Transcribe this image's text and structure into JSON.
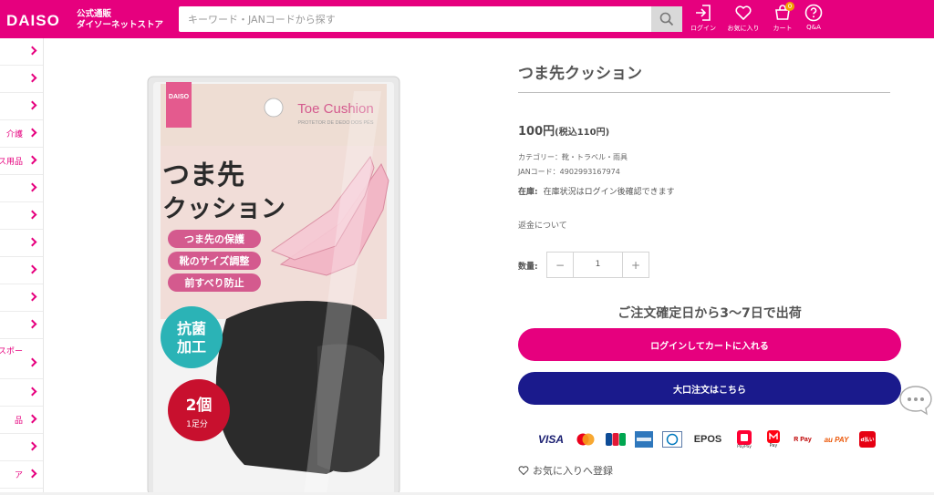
{
  "header": {
    "logo": "DAISO",
    "logo_sub_1": "公式通販",
    "logo_sub_2": "ダイソーネットストア",
    "search_placeholder": "キーワード・JANコードから探す",
    "nav": {
      "login": "ログイン",
      "favorites": "お気に入り",
      "cart": "カート",
      "cart_count": "0",
      "qa": "Q&A"
    }
  },
  "sidebar": {
    "items": [
      "",
      "",
      "",
      "介護",
      "ス用品",
      "",
      "",
      "",
      "",
      "",
      "",
      "スポー",
      "",
      "品",
      "",
      "ア"
    ]
  },
  "product": {
    "title": "つま先クッション",
    "price": "100円",
    "price_tax": "(税込110円)",
    "category": "カテゴリー：靴・トラベル・雨具",
    "jan": "JANコード：4902993167974",
    "stock_label": "在庫:",
    "stock_value": "在庫状況はログイン後確認できます",
    "refund": "返金について",
    "qty_label": "数量:",
    "qty_minus": "−",
    "qty_value": "1",
    "qty_plus": "+",
    "shipping": "ご注文確定日から3〜7日で出荷",
    "cart_button": "ログインしてカートに入れる",
    "bulk_button": "大口注文はこちら",
    "favorite_link": "お気に入りへ登録"
  },
  "package": {
    "brand": "DAISO",
    "name_en": "Toe Cushion",
    "name_pt": "PROTETOR DE DEDO DOS PÉS",
    "name_jp_1": "つま先",
    "name_jp_2": "クッション",
    "feature_1": "つま先の保護",
    "feature_2": "靴のサイズ調整",
    "feature_3": "前すべり防止",
    "badge_1": "抗菌",
    "badge_2": "加工",
    "count": "2個",
    "count_sub": "1足分"
  },
  "payments": [
    "VISA",
    "Mastercard",
    "JCB",
    "American Express",
    "Diners Club",
    "EPOS",
    "PayPay",
    "メルペイ",
    "楽天ペイ",
    "au PAY",
    "d払い"
  ],
  "payment_labels": {
    "visa": "VISA",
    "epos": "EPOS",
    "au": "au PAY",
    "paypay": "PayPay",
    "merpay": "Pay",
    "rakuten": "R Pay",
    "dbarai": "d払い"
  },
  "colors": {
    "brand_pink": "#e6007e",
    "navy": "#1a1a8c",
    "teal": "#2bb3b6",
    "badge_red": "#c8102e"
  }
}
